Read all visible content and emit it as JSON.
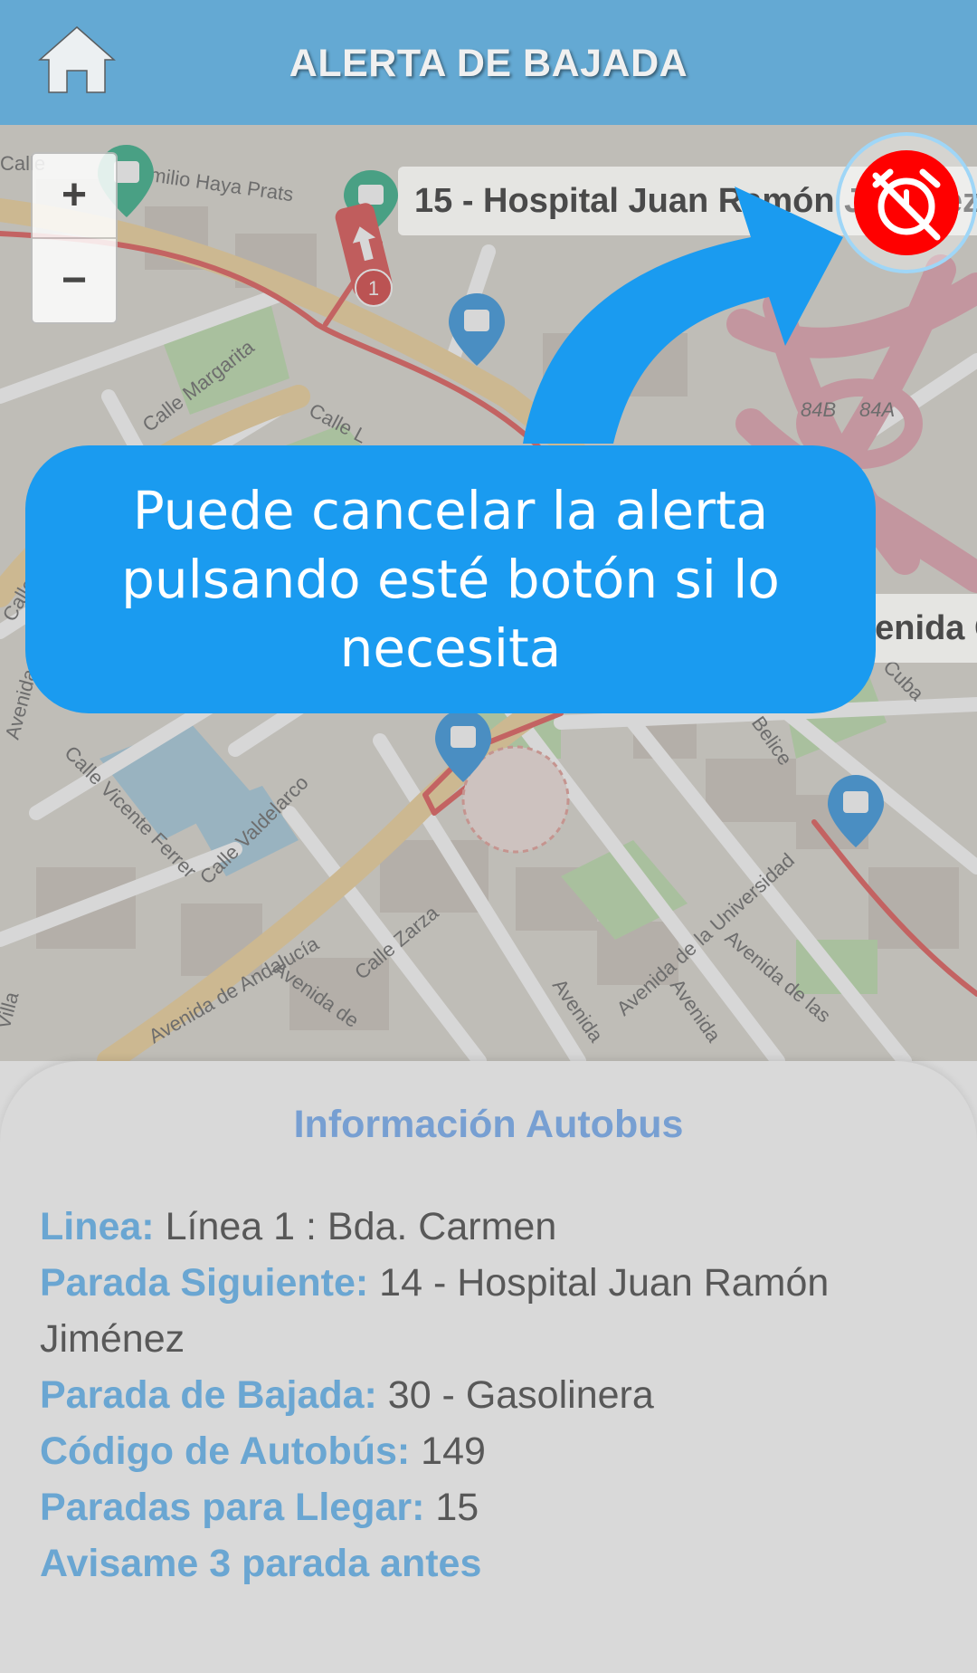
{
  "header": {
    "title": "ALERTA DE BAJADA",
    "home_icon": "home-icon"
  },
  "map": {
    "zoom_in_label": "+",
    "zoom_out_label": "−",
    "stop_labels": [
      "15 - Hospital Juan Ramón Jiménez",
      "Avenida Cristina Alcalde"
    ],
    "street_labels": {
      "s1": "Emilio Haya Prats",
      "s2": "Calle Margarita",
      "s3": "Calle L",
      "s4": "Calle Vicente Ferrer",
      "s5": "Calle Valdelarco",
      "s6": "Calle Zarza",
      "s7": "Avenida de",
      "s8": "Avenida de la Universidad",
      "s9": "Avenida de las",
      "s10": "Avenida de Andalucía",
      "s11": "Belice",
      "s12": "Cuba",
      "s13": "Calle",
      "s14": "84B",
      "s15": "84A",
      "s16": "Avenida",
      "s17": "Calle",
      "s18": "Avenida",
      "s19": "Avenida de",
      "s20": "Villa"
    },
    "bus_badge": "1",
    "colors": {
      "route": "#e45f5d",
      "highway": "#e3a0ae",
      "avenue": "#f0cf9d",
      "green": "#c5e0b5",
      "stop_pin": "#3c9ae2",
      "stop_pin_green": "#3bb38c"
    }
  },
  "tooltip": {
    "text": "Puede cancelar la alerta pulsando esté botón si lo necesita",
    "color": "#1a9bf0"
  },
  "alarm_button": {
    "icon": "alarm-off-icon",
    "color": "#ff0000"
  },
  "info": {
    "title": "Información Autobus",
    "linea_label": "Linea:",
    "linea_value": "Línea 1 : Bda. Carmen",
    "siguiente_label": "Parada Siguiente:",
    "siguiente_value": "14 - Hospital Juan Ramón Jiménez",
    "bajada_label": "Parada de Bajada:",
    "bajada_value": "30 - Gasolinera",
    "codigo_label": "Código de Autobús:",
    "codigo_value": "149",
    "paradas_label": "Paradas para Llegar:",
    "paradas_value": "15",
    "aviso": "Avisame 3 parada antes"
  }
}
